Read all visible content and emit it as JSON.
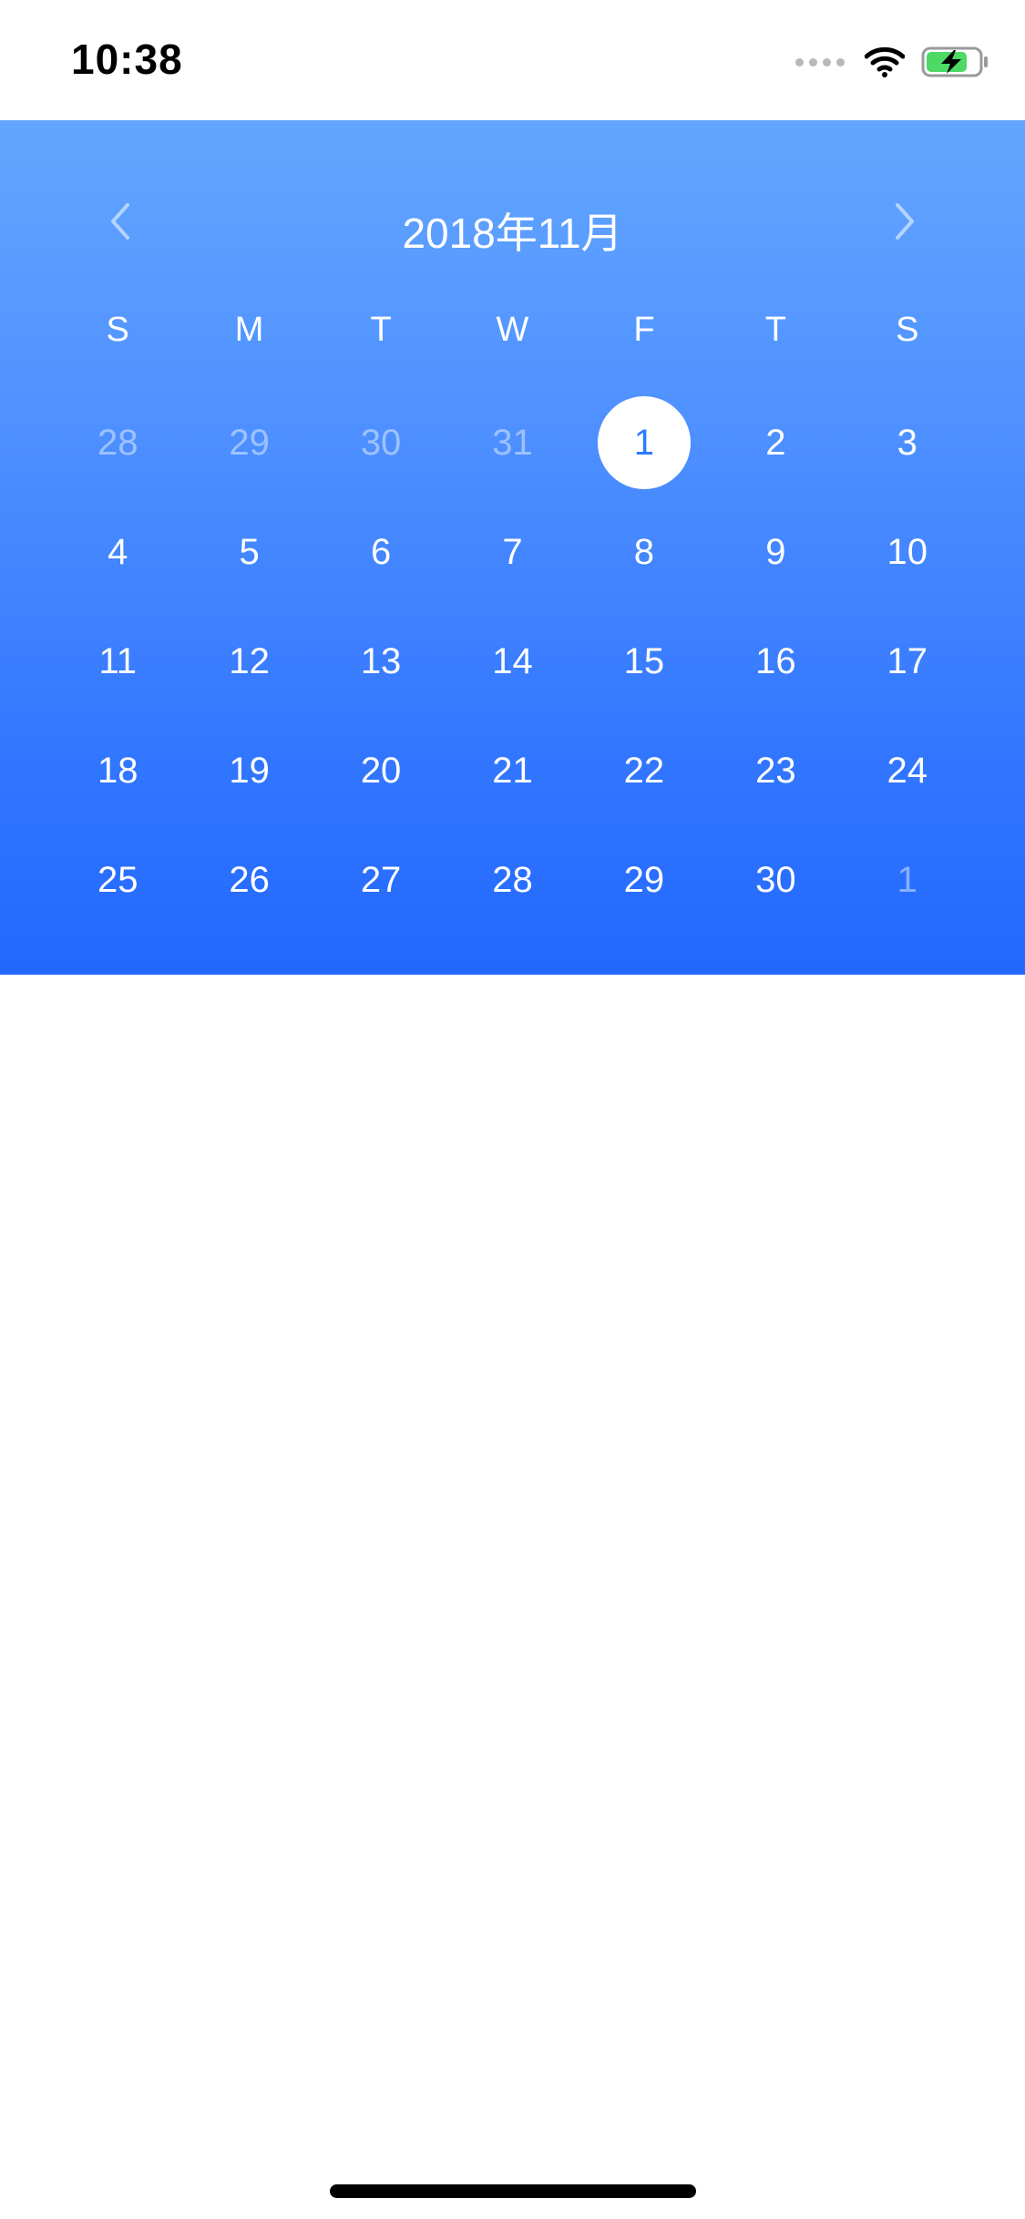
{
  "status_bar": {
    "time": "10:38",
    "icons": [
      "signal-dots-icon",
      "wifi-icon",
      "battery-charging-icon"
    ]
  },
  "calendar": {
    "title": "2018年11月",
    "prev_icon": "chevron-left-icon",
    "next_icon": "chevron-right-icon",
    "colors": {
      "gradient_top": "#62a6ff",
      "gradient_bottom": "#2268ff",
      "selected_bg": "#ffffff",
      "selected_text": "#2b7bff"
    },
    "weekdays": [
      "S",
      "M",
      "T",
      "W",
      "F",
      "T",
      "S"
    ],
    "weeks": [
      {
        "days": [
          {
            "label": "28",
            "muted": true
          },
          {
            "label": "29",
            "muted": true
          },
          {
            "label": "30",
            "muted": true
          },
          {
            "label": "31",
            "muted": true
          },
          {
            "label": "1",
            "selected": true
          },
          {
            "label": "2"
          },
          {
            "label": "3"
          }
        ]
      },
      {
        "days": [
          {
            "label": "4"
          },
          {
            "label": "5"
          },
          {
            "label": "6"
          },
          {
            "label": "7"
          },
          {
            "label": "8"
          },
          {
            "label": "9"
          },
          {
            "label": "10"
          }
        ]
      },
      {
        "days": [
          {
            "label": "11"
          },
          {
            "label": "12"
          },
          {
            "label": "13"
          },
          {
            "label": "14"
          },
          {
            "label": "15"
          },
          {
            "label": "16"
          },
          {
            "label": "17"
          }
        ]
      },
      {
        "days": [
          {
            "label": "18"
          },
          {
            "label": "19"
          },
          {
            "label": "20"
          },
          {
            "label": "21"
          },
          {
            "label": "22"
          },
          {
            "label": "23"
          },
          {
            "label": "24"
          }
        ]
      },
      {
        "days": [
          {
            "label": "25"
          },
          {
            "label": "26"
          },
          {
            "label": "27"
          },
          {
            "label": "28"
          },
          {
            "label": "29"
          },
          {
            "label": "30"
          },
          {
            "label": "1",
            "muted": true
          }
        ]
      }
    ]
  }
}
